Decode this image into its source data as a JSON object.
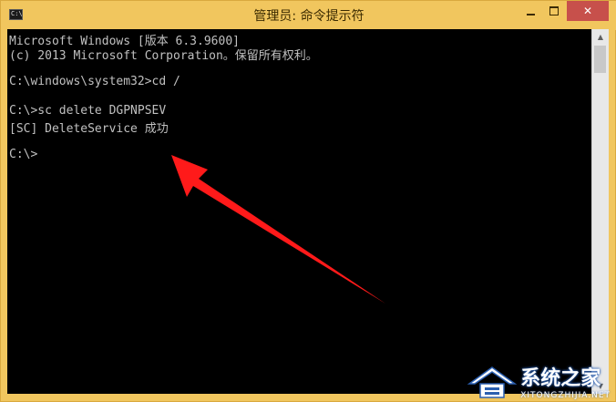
{
  "window": {
    "title": "管理员: 命令提示符",
    "icon": "cmd-icon",
    "icon_label": "C:\\",
    "controls": {
      "minimize": "minimize-icon",
      "maximize": "maximize-icon",
      "close_label": "✕"
    },
    "colors": {
      "titlebar": "#f1c65e",
      "close": "#c7504b",
      "console_bg": "#000000",
      "console_text": "#c0c0c0"
    }
  },
  "console": {
    "lines": [
      "Microsoft Windows [版本 6.3.9600]",
      "(c) 2013 Microsoft Corporation。保留所有权利。",
      "",
      "C:\\windows\\system32>cd /",
      "",
      "C:\\>sc delete DGPNPSEV",
      "[SC] DeleteService 成功",
      "",
      "C:\\>"
    ]
  },
  "annotation": {
    "arrow_color": "#ff1a1a",
    "icon": "red-arrow-icon"
  },
  "watermark": {
    "text_cn": "系统之家",
    "text_en": "XITONGZHIJIA.NET",
    "icon": "house-logo-icon"
  }
}
